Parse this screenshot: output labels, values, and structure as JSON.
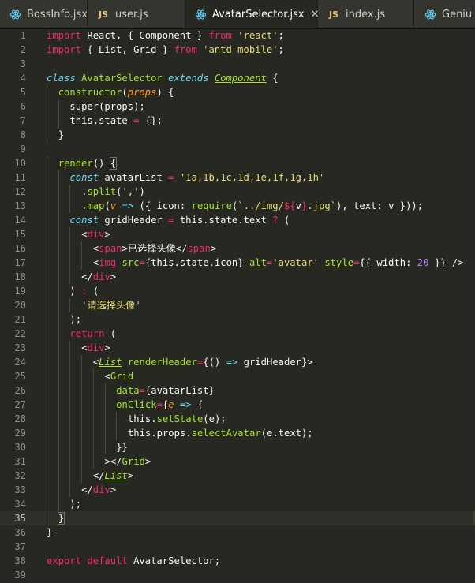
{
  "tabs": [
    {
      "label": "BossInfo.jsx",
      "icon": "react-icon",
      "active": false,
      "width": 111
    },
    {
      "label": "user.js",
      "icon": "js-icon",
      "active": false,
      "width": 124
    },
    {
      "label": "AvatarSelector.jsx",
      "icon": "react-icon",
      "active": true,
      "width": 168,
      "close": "✕"
    },
    {
      "label": "index.js",
      "icon": "js-icon",
      "active": false,
      "width": 122
    },
    {
      "label": "Geniu",
      "icon": "react-icon",
      "active": false,
      "width": 90
    }
  ],
  "current_line": 35,
  "lines": [
    {
      "n": "1",
      "indent": 0,
      "t": [
        [
          "kw",
          "import"
        ],
        [
          "pl",
          " React, { Component } "
        ],
        [
          "kw",
          "from"
        ],
        [
          "pl",
          " "
        ],
        [
          "st",
          "'react'"
        ],
        [
          "pl",
          ";"
        ]
      ]
    },
    {
      "n": "2",
      "indent": 0,
      "t": [
        [
          "kw",
          "import"
        ],
        [
          "pl",
          " { List, Grid } "
        ],
        [
          "kw",
          "from"
        ],
        [
          "pl",
          " "
        ],
        [
          "st",
          "'antd-mobile'"
        ],
        [
          "pl",
          ";"
        ]
      ]
    },
    {
      "n": "3",
      "indent": 0,
      "t": []
    },
    {
      "n": "4",
      "indent": 0,
      "t": [
        [
          "st2",
          "class"
        ],
        [
          "pl",
          " "
        ],
        [
          "fn",
          "AvatarSelector"
        ],
        [
          "pl",
          " "
        ],
        [
          "st2",
          "extends"
        ],
        [
          "pl",
          " "
        ],
        [
          "cls",
          "Component"
        ],
        [
          "pl",
          " {"
        ]
      ]
    },
    {
      "n": "5",
      "indent": 1,
      "t": [
        [
          "fn",
          "constructor"
        ],
        [
          "pl",
          "("
        ],
        [
          "pr",
          "props"
        ],
        [
          "pl",
          ") {"
        ]
      ]
    },
    {
      "n": "6",
      "indent": 2,
      "t": [
        [
          "pl",
          "super(props);"
        ]
      ]
    },
    {
      "n": "7",
      "indent": 2,
      "t": [
        [
          "pl",
          "this.state "
        ],
        [
          "kw",
          "="
        ],
        [
          "pl",
          " {};"
        ]
      ]
    },
    {
      "n": "8",
      "indent": 1,
      "t": [
        [
          "pl",
          "}"
        ]
      ]
    },
    {
      "n": "9",
      "indent": 0,
      "t": []
    },
    {
      "n": "10",
      "indent": 1,
      "t": [
        [
          "fn",
          "render"
        ],
        [
          "pl",
          "() "
        ],
        [
          "brk",
          "{"
        ]
      ]
    },
    {
      "n": "11",
      "indent": 2,
      "t": [
        [
          "st2",
          "const"
        ],
        [
          "pl",
          " avatarList "
        ],
        [
          "kw",
          "="
        ],
        [
          "pl",
          " "
        ],
        [
          "st",
          "'1a,1b,1c,1d,1e,1f,1g,1h'"
        ]
      ]
    },
    {
      "n": "12",
      "indent": 3,
      "t": [
        [
          "pl",
          "."
        ],
        [
          "fn",
          "split"
        ],
        [
          "pl",
          "("
        ],
        [
          "st",
          "','"
        ],
        [
          "pl",
          ")"
        ]
      ]
    },
    {
      "n": "13",
      "indent": 3,
      "t": [
        [
          "pl",
          "."
        ],
        [
          "fn",
          "map"
        ],
        [
          "pl",
          "("
        ],
        [
          "pr",
          "v"
        ],
        [
          "pl",
          " "
        ],
        [
          "st2",
          "=>"
        ],
        [
          "pl",
          " ({ icon: "
        ],
        [
          "fn",
          "require"
        ],
        [
          "pl",
          "("
        ],
        [
          "st",
          "`../img/"
        ],
        [
          "kw",
          "${"
        ],
        [
          "pl",
          "v"
        ],
        [
          "kw",
          "}"
        ],
        [
          "st",
          ".jpg`"
        ],
        [
          "pl",
          "), text: v }));"
        ]
      ]
    },
    {
      "n": "14",
      "indent": 2,
      "t": [
        [
          "st2",
          "const"
        ],
        [
          "pl",
          " gridHeader "
        ],
        [
          "kw",
          "="
        ],
        [
          "pl",
          " this.state.text "
        ],
        [
          "kw",
          "?"
        ],
        [
          "pl",
          " ("
        ]
      ]
    },
    {
      "n": "15",
      "indent": 3,
      "t": [
        [
          "pl",
          "<"
        ],
        [
          "kw",
          "div"
        ],
        [
          "pl",
          ">"
        ]
      ]
    },
    {
      "n": "16",
      "indent": 4,
      "t": [
        [
          "pl",
          "<"
        ],
        [
          "kw",
          "span"
        ],
        [
          "pl",
          ">已选择头像</"
        ],
        [
          "kw",
          "span"
        ],
        [
          "pl",
          ">"
        ]
      ]
    },
    {
      "n": "17",
      "indent": 4,
      "t": [
        [
          "pl",
          "<"
        ],
        [
          "kw",
          "img"
        ],
        [
          "pl",
          " "
        ],
        [
          "fn",
          "src"
        ],
        [
          "kw",
          "="
        ],
        [
          "pl",
          "{this.state.icon} "
        ],
        [
          "fn",
          "alt"
        ],
        [
          "kw",
          "="
        ],
        [
          "st",
          "'avatar'"
        ],
        [
          "pl",
          " "
        ],
        [
          "fn",
          "style"
        ],
        [
          "kw",
          "="
        ],
        [
          "pl",
          "{{ width: "
        ],
        [
          "num",
          "20"
        ],
        [
          "pl",
          " }} />"
        ]
      ]
    },
    {
      "n": "18",
      "indent": 3,
      "t": [
        [
          "pl",
          "</"
        ],
        [
          "kw",
          "div"
        ],
        [
          "pl",
          ">"
        ]
      ]
    },
    {
      "n": "19",
      "indent": 2,
      "t": [
        [
          "pl",
          ") "
        ],
        [
          "kw",
          ":"
        ],
        [
          "pl",
          " ("
        ]
      ]
    },
    {
      "n": "20",
      "indent": 3,
      "t": [
        [
          "st",
          "'请选择头像'"
        ]
      ]
    },
    {
      "n": "21",
      "indent": 2,
      "t": [
        [
          "pl",
          ");"
        ]
      ]
    },
    {
      "n": "22",
      "indent": 2,
      "t": [
        [
          "kw",
          "return"
        ],
        [
          "pl",
          " ("
        ]
      ]
    },
    {
      "n": "23",
      "indent": 3,
      "t": [
        [
          "pl",
          "<"
        ],
        [
          "kw",
          "div"
        ],
        [
          "pl",
          ">"
        ]
      ]
    },
    {
      "n": "24",
      "indent": 4,
      "t": [
        [
          "pl",
          "<"
        ],
        [
          "cls",
          "List"
        ],
        [
          "pl",
          " "
        ],
        [
          "fn",
          "renderHeader"
        ],
        [
          "kw",
          "="
        ],
        [
          "pl",
          "{() "
        ],
        [
          "st2",
          "=>"
        ],
        [
          "pl",
          " gridHeader}>"
        ]
      ]
    },
    {
      "n": "25",
      "indent": 5,
      "t": [
        [
          "pl",
          "<"
        ],
        [
          "fn",
          "Grid"
        ]
      ]
    },
    {
      "n": "26",
      "indent": 6,
      "t": [
        [
          "fn",
          "data"
        ],
        [
          "kw",
          "="
        ],
        [
          "pl",
          "{avatarList}"
        ]
      ]
    },
    {
      "n": "27",
      "indent": 6,
      "t": [
        [
          "fn",
          "onClick"
        ],
        [
          "kw",
          "="
        ],
        [
          "pl",
          "{"
        ],
        [
          "pr",
          "e"
        ],
        [
          "pl",
          " "
        ],
        [
          "st2",
          "=>"
        ],
        [
          "pl",
          " {"
        ]
      ]
    },
    {
      "n": "28",
      "indent": 7,
      "t": [
        [
          "pl",
          "this."
        ],
        [
          "fn",
          "setState"
        ],
        [
          "pl",
          "(e);"
        ]
      ]
    },
    {
      "n": "29",
      "indent": 7,
      "t": [
        [
          "pl",
          "this.props."
        ],
        [
          "fn",
          "selectAvatar"
        ],
        [
          "pl",
          "(e.text);"
        ]
      ]
    },
    {
      "n": "30",
      "indent": 6,
      "t": [
        [
          "pl",
          "}}"
        ]
      ]
    },
    {
      "n": "31",
      "indent": 5,
      "t": [
        [
          "pl",
          "></"
        ],
        [
          "fn",
          "Grid"
        ],
        [
          "pl",
          ">"
        ]
      ]
    },
    {
      "n": "32",
      "indent": 4,
      "t": [
        [
          "pl",
          "</"
        ],
        [
          "cls",
          "List"
        ],
        [
          "pl",
          ">"
        ]
      ]
    },
    {
      "n": "33",
      "indent": 3,
      "t": [
        [
          "pl",
          "</"
        ],
        [
          "kw",
          "div"
        ],
        [
          "pl",
          ">"
        ]
      ]
    },
    {
      "n": "34",
      "indent": 2,
      "t": [
        [
          "pl",
          ");"
        ]
      ]
    },
    {
      "n": "35",
      "indent": 1,
      "t": [
        [
          "brk",
          "}"
        ]
      ]
    },
    {
      "n": "36",
      "indent": 0,
      "t": [
        [
          "pl",
          "}"
        ]
      ]
    },
    {
      "n": "37",
      "indent": 0,
      "t": []
    },
    {
      "n": "38",
      "indent": 0,
      "t": [
        [
          "kw",
          "export"
        ],
        [
          "pl",
          " "
        ],
        [
          "kw",
          "default"
        ],
        [
          "pl",
          " AvatarSelector;"
        ]
      ]
    },
    {
      "n": "39",
      "indent": 0,
      "t": []
    }
  ]
}
